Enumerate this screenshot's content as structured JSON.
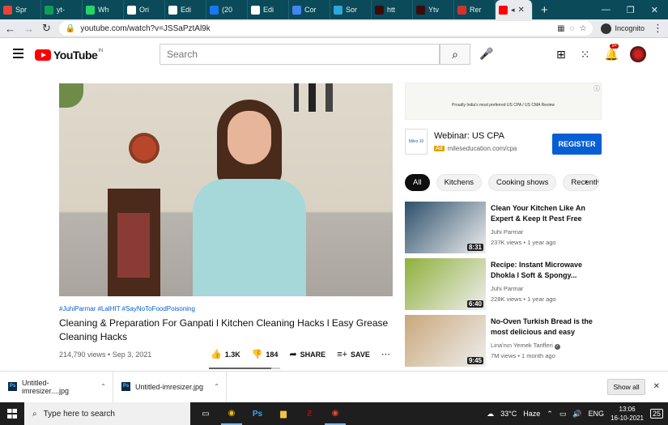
{
  "browser": {
    "tabs": [
      {
        "title": "Spr",
        "fav": "gmail-icon",
        "color": "#ea4335"
      },
      {
        "title": "yt-",
        "fav": "sheets-icon",
        "color": "#0f9d58"
      },
      {
        "title": "Wh",
        "fav": "whatsapp-icon",
        "color": "#25d366"
      },
      {
        "title": "Ori",
        "fav": "yt-studio-icon",
        "color": "#ffffff"
      },
      {
        "title": "Edi",
        "fav": "yt-studio-icon",
        "color": "#ffffff"
      },
      {
        "title": "(20",
        "fav": "facebook-icon",
        "color": "#1877f2"
      },
      {
        "title": "Edi",
        "fav": "globe-icon",
        "color": "#ffffff"
      },
      {
        "title": "Cor",
        "fav": "doc-icon",
        "color": "#4285f4"
      },
      {
        "title": "Sor",
        "fav": "sort-icon",
        "color": "#2aa8d8"
      },
      {
        "title": "htt",
        "fav": "link-icon",
        "color": "#3a0b0b"
      },
      {
        "title": "Ytv",
        "fav": "link-icon",
        "color": "#3a0b0b"
      },
      {
        "title": "Rer",
        "fav": "rename-icon",
        "color": "#d0342c"
      }
    ],
    "active_tab": {
      "fav": "youtube-icon",
      "color": "#ff0000"
    },
    "new_tab": "+",
    "url": "youtube.com/watch?v=JSSaPztAl9k",
    "incognito_label": "Incognito"
  },
  "youtube": {
    "logo_text": "YouTube",
    "logo_region": "IN",
    "search_placeholder": "Search",
    "notification_count": "9+"
  },
  "video": {
    "tags": "#JuhiParmar #LalHIT #SayNoToFoodPoisoning",
    "title": "Cleaning & Preparation For Ganpati l Kitchen Cleaning Hacks l Easy Grease Cleaning Hacks",
    "meta": "214,790 views • Sep 3, 2021",
    "likes": "1.3K",
    "dislikes": "184",
    "share_label": "SHARE",
    "save_label": "SAVE",
    "like_ratio": 0.87
  },
  "ad": {
    "banner_text": "Proudly India's most preferred US CPA / US CMA Review",
    "logo_text": "Miles 10",
    "title": "Webinar: US CPA",
    "ad_tag": "Ad",
    "domain": "mileseducation.com/cpa",
    "cta": "REGISTER"
  },
  "chips": [
    "All",
    "Kitchens",
    "Cooking shows",
    "Recently u"
  ],
  "recommendations": [
    {
      "title": "Clean Your Kitchen Like An Expert & Keep It Pest Free",
      "channel": "Juhi Parmar",
      "stats": "237K views • 1 year ago",
      "duration": "8:31",
      "thumb_color": "#2c4f6a"
    },
    {
      "title": "Recipe: Instant Microwave Dhokla l Soft & Spongy...",
      "channel": "Juhi Parmar",
      "stats": "228K views • 1 year ago",
      "duration": "6:40",
      "thumb_color": "#8fb03c"
    },
    {
      "title": "No-Oven Turkish Bread is the most delicious and easy brea...",
      "channel": "Lina'nın Yemek Tarifleri",
      "stats": "7M views • 1 month ago",
      "duration": "9:45",
      "thumb_color": "#c9a77a"
    }
  ],
  "downloads": {
    "items": [
      "Untitled-imresizer....jpg",
      "Untitled-imresizer.jpg"
    ],
    "show_all": "Show all"
  },
  "taskbar": {
    "search_placeholder": "Type here to search",
    "weather": "33°C",
    "weather_desc": "Haze",
    "lang": "ENG",
    "time": "13:06",
    "date": "16-10-2021",
    "notif_count": "25"
  }
}
